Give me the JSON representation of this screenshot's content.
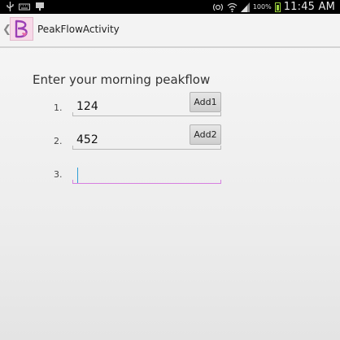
{
  "status_bar": {
    "icons": [
      "usb-icon",
      "keyboard-icon",
      "notification-icon",
      "nfc-icon",
      "wifi-icon",
      "signal-icon",
      "battery-icon"
    ],
    "battery_percent": "100%",
    "time": "11:45 AM",
    "battery_color": "#9bd23c"
  },
  "action_bar": {
    "title": "PeakFlowActivity",
    "logo_letter": "B",
    "logo_color": "#9b3fb5"
  },
  "form": {
    "prompt": "Enter your morning peakflow",
    "rows": [
      {
        "number": "1.",
        "value": "124",
        "button_label": "Add1"
      },
      {
        "number": "2.",
        "value": "452",
        "button_label": "Add2"
      },
      {
        "number": "3.",
        "value": ""
      }
    ],
    "active_underline_color": "#d67fe0",
    "cursor_color": "#2f9fd6"
  }
}
